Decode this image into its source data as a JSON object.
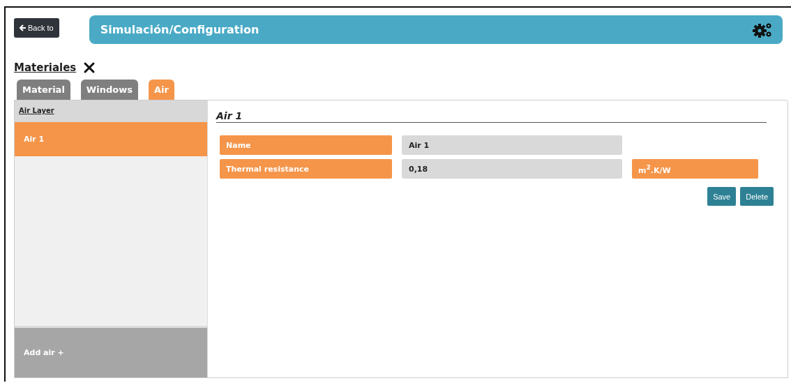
{
  "back_button": "Back to",
  "header": {
    "title": "Simulación/Configuration"
  },
  "section_title": "Materiales",
  "tabs": [
    {
      "label": "Material",
      "selected": false
    },
    {
      "label": "Windows",
      "selected": false
    },
    {
      "label": "Air",
      "selected": true
    }
  ],
  "sidebar": {
    "title": "Air Layer",
    "items": [
      {
        "label": "Air 1",
        "selected": true
      }
    ],
    "add_button": "Add air +"
  },
  "detail": {
    "title": "Air 1",
    "fields": [
      {
        "label": "Name",
        "value": "Air 1"
      },
      {
        "label": "Thermal resistance",
        "value": "0,18",
        "unit": "m$^{2}$.K/W"
      }
    ],
    "buttons": [
      "Save",
      "Delete"
    ]
  }
}
